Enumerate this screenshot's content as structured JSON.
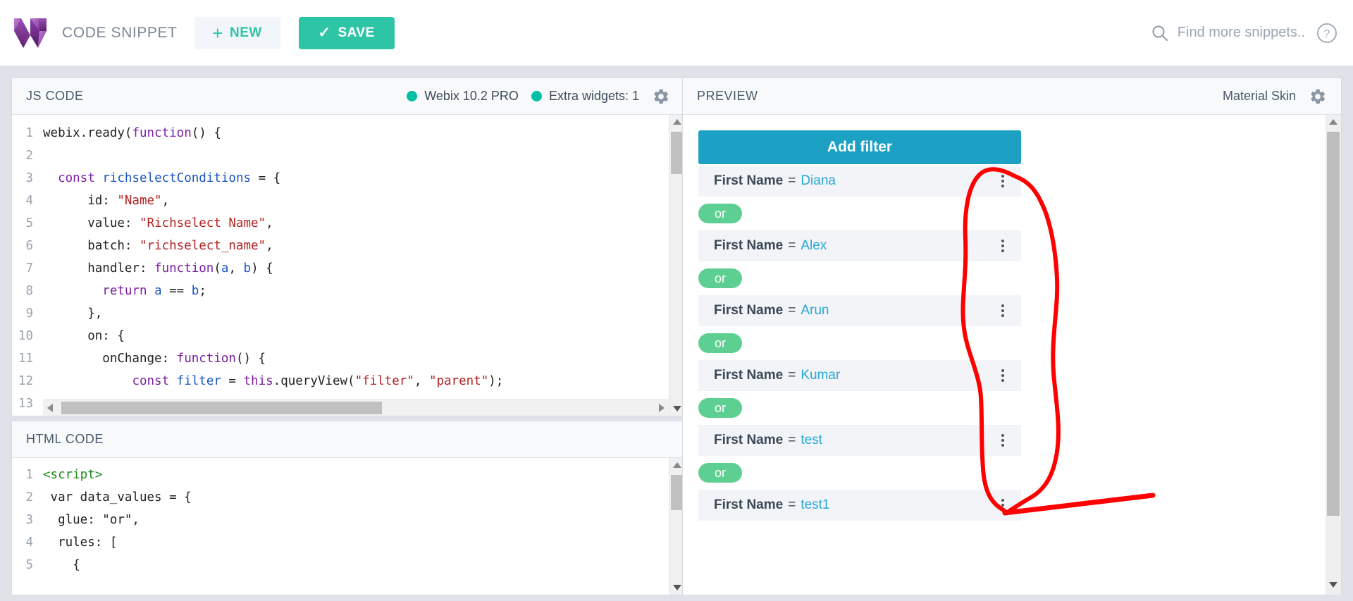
{
  "topbar": {
    "brand_title": "CODE SNIPPET",
    "new_label": "NEW",
    "new_icon": "plus-icon",
    "save_label": "SAVE",
    "save_icon": "check-icon",
    "search_placeholder": "Find more snippets..",
    "search_icon": "search-icon",
    "help_icon": "help-circle-icon",
    "accent_teal": "#2ec4a6"
  },
  "js_panel": {
    "title": "JS CODE",
    "badges": [
      {
        "label": "Webix 10.2 PRO",
        "dot_color": "#00bfa5"
      },
      {
        "label": "Extra widgets: 1",
        "dot_color": "#00bfa5"
      }
    ],
    "settings_icon": "gear-icon",
    "lines": [
      {
        "n": "1",
        "tokens": [
          {
            "t": "plain",
            "v": "webix.ready("
          },
          {
            "t": "kw",
            "v": "function"
          },
          {
            "t": "plain",
            "v": "() {"
          }
        ]
      },
      {
        "n": "2",
        "tokens": [
          {
            "t": "plain",
            "v": ""
          }
        ]
      },
      {
        "n": "3",
        "tokens": [
          {
            "t": "plain",
            "v": "  "
          },
          {
            "t": "kw",
            "v": "const"
          },
          {
            "t": "plain",
            "v": " "
          },
          {
            "t": "var",
            "v": "richselectConditions"
          },
          {
            "t": "plain",
            "v": " = {"
          }
        ]
      },
      {
        "n": "4",
        "tokens": [
          {
            "t": "plain",
            "v": "      id: "
          },
          {
            "t": "str",
            "v": "\"Name\""
          },
          {
            "t": "plain",
            "v": ","
          }
        ]
      },
      {
        "n": "5",
        "tokens": [
          {
            "t": "plain",
            "v": "      value: "
          },
          {
            "t": "str",
            "v": "\"Richselect Name\""
          },
          {
            "t": "plain",
            "v": ","
          }
        ]
      },
      {
        "n": "6",
        "tokens": [
          {
            "t": "plain",
            "v": "      batch: "
          },
          {
            "t": "str",
            "v": "\"richselect_name\""
          },
          {
            "t": "plain",
            "v": ","
          }
        ]
      },
      {
        "n": "7",
        "tokens": [
          {
            "t": "plain",
            "v": "      handler: "
          },
          {
            "t": "kw",
            "v": "function"
          },
          {
            "t": "plain",
            "v": "("
          },
          {
            "t": "var",
            "v": "a"
          },
          {
            "t": "plain",
            "v": ", "
          },
          {
            "t": "var",
            "v": "b"
          },
          {
            "t": "plain",
            "v": ") {"
          }
        ]
      },
      {
        "n": "8",
        "tokens": [
          {
            "t": "plain",
            "v": "        "
          },
          {
            "t": "kw",
            "v": "return"
          },
          {
            "t": "plain",
            "v": " "
          },
          {
            "t": "var",
            "v": "a"
          },
          {
            "t": "plain",
            "v": " == "
          },
          {
            "t": "var",
            "v": "b"
          },
          {
            "t": "plain",
            "v": ";"
          }
        ]
      },
      {
        "n": "9",
        "tokens": [
          {
            "t": "plain",
            "v": "      },"
          }
        ]
      },
      {
        "n": "10",
        "tokens": [
          {
            "t": "plain",
            "v": "      on: {"
          }
        ]
      },
      {
        "n": "11",
        "tokens": [
          {
            "t": "plain",
            "v": "        onChange: "
          },
          {
            "t": "kw",
            "v": "function"
          },
          {
            "t": "plain",
            "v": "() {"
          }
        ]
      },
      {
        "n": "12",
        "tokens": [
          {
            "t": "plain",
            "v": "            "
          },
          {
            "t": "kw",
            "v": "const"
          },
          {
            "t": "plain",
            "v": " "
          },
          {
            "t": "var",
            "v": "filter"
          },
          {
            "t": "plain",
            "v": " = "
          },
          {
            "t": "kw",
            "v": "this"
          },
          {
            "t": "plain",
            "v": ".queryView("
          },
          {
            "t": "str",
            "v": "\"filter\""
          },
          {
            "t": "plain",
            "v": ", "
          },
          {
            "t": "str",
            "v": "\"parent\""
          },
          {
            "t": "plain",
            "v": ");"
          }
        ]
      },
      {
        "n": "13",
        "tokens": [
          {
            "t": "plain",
            "v": ""
          }
        ]
      }
    ]
  },
  "html_panel": {
    "title": "HTML CODE",
    "lines": [
      {
        "n": "1",
        "tokens": [
          {
            "t": "tag",
            "v": "<script>"
          }
        ]
      },
      {
        "n": "2",
        "tokens": [
          {
            "t": "plain",
            "v": " var data_values = {"
          }
        ]
      },
      {
        "n": "3",
        "tokens": [
          {
            "t": "plain",
            "v": "  glue: \"or\","
          }
        ]
      },
      {
        "n": "4",
        "tokens": [
          {
            "t": "plain",
            "v": "  rules: ["
          }
        ]
      },
      {
        "n": "5",
        "tokens": [
          {
            "t": "plain",
            "v": "    {"
          }
        ]
      }
    ]
  },
  "preview_panel": {
    "title": "PREVIEW",
    "skin_label": "Material Skin",
    "settings_icon": "gear-icon",
    "widget": {
      "add_filter_label": "Add filter",
      "add_filter_color": "#1ca1c4",
      "glue_label": "or",
      "glue_color": "#5ecf92",
      "field_label": "First Name",
      "operator": "=",
      "menu_icon": "kebab-menu-icon",
      "rules": [
        {
          "field": "First Name",
          "operator": "=",
          "value": "Diana"
        },
        {
          "field": "First Name",
          "operator": "=",
          "value": "Alex"
        },
        {
          "field": "First Name",
          "operator": "=",
          "value": "Arun"
        },
        {
          "field": "First Name",
          "operator": "=",
          "value": "Kumar"
        },
        {
          "field": "First Name",
          "operator": "=",
          "value": "test"
        },
        {
          "field": "First Name",
          "operator": "=",
          "value": "test1"
        }
      ]
    }
  },
  "annotation": {
    "color": "#ff0000",
    "description": "hand-drawn red circle around preview scrollbar with pointer line"
  }
}
